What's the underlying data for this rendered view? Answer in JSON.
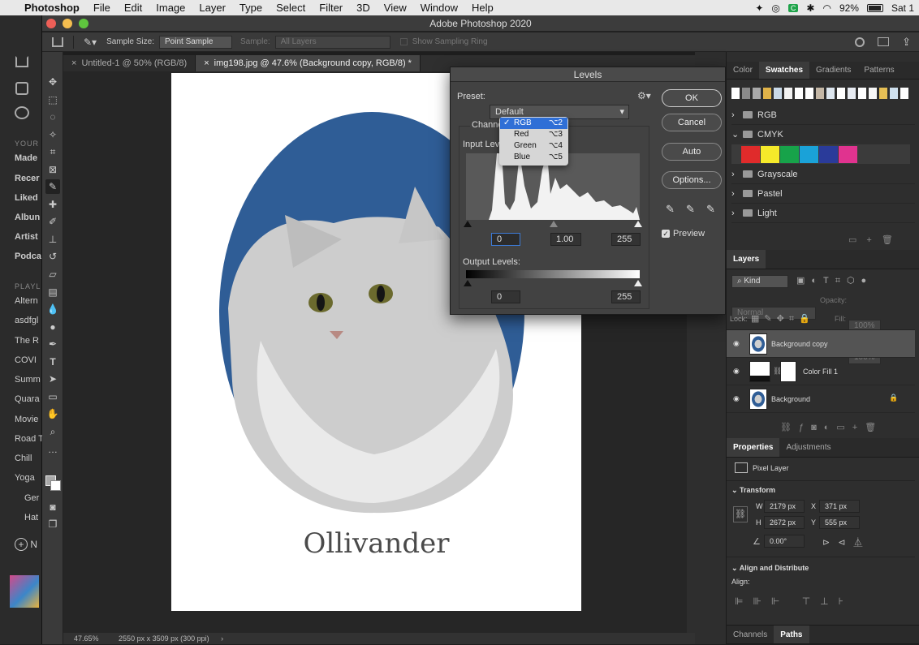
{
  "menubar": {
    "app_name": "Photoshop",
    "items": [
      "File",
      "Edit",
      "Image",
      "Layer",
      "Type",
      "Select",
      "Filter",
      "3D",
      "View",
      "Window",
      "Help"
    ],
    "battery": "92%",
    "clock": "Sat 1"
  },
  "music_sidebar": {
    "section_label": "YOUR",
    "items": [
      "Made",
      "Recer",
      "Liked",
      "Albun",
      "Artist",
      "Podca"
    ],
    "playlists_label": "PLAYL",
    "playlists": [
      "Altern",
      "asdfgl",
      "The R",
      "COVI",
      "Summ",
      "Quara",
      "Movie",
      "Road T",
      "Chill",
      "Yoga",
      "Ger",
      "Hat"
    ],
    "new_label": "N"
  },
  "window": {
    "title": "Adobe Photoshop 2020"
  },
  "options_bar": {
    "sample_size_label": "Sample Size:",
    "sample_size_value": "Point Sample",
    "sample_label": "Sample:",
    "sample_value": "All Layers",
    "ring_label": "Show Sampling Ring"
  },
  "tabs": [
    {
      "label": "Untitled-1 @ 50% (RGB/8)"
    },
    {
      "label": "img198.jpg @ 47.6% (Background copy, RGB/8) *"
    }
  ],
  "canvas": {
    "caption": "Ollivander"
  },
  "status": {
    "zoom": "47.65%",
    "doc_info": "2550 px x 3509 px (300 ppi)"
  },
  "levels": {
    "title": "Levels",
    "preset_label": "Preset:",
    "preset_value": "Default",
    "channel_label": "Channe",
    "input_label": "Input Leve",
    "input_black": "0",
    "input_gamma": "1.00",
    "input_white": "255",
    "output_label": "Output Levels:",
    "output_black": "0",
    "output_white": "255",
    "ok": "OK",
    "cancel": "Cancel",
    "auto": "Auto",
    "options": "Options...",
    "preview": "Preview",
    "channel_menu": [
      {
        "label": "RGB",
        "shortcut": "⌥2",
        "selected": true
      },
      {
        "label": "Red",
        "shortcut": "⌥3"
      },
      {
        "label": "Green",
        "shortcut": "⌥4"
      },
      {
        "label": "Blue",
        "shortcut": "⌥5"
      }
    ]
  },
  "swatches_panel": {
    "tabs": [
      "Color",
      "Swatches",
      "Gradients",
      "Patterns"
    ],
    "active_tab": "Swatches",
    "folders": [
      "RGB",
      "CMYK",
      "Grayscale",
      "Pastel",
      "Light"
    ],
    "cmyk_colors": [
      "#e02b2b",
      "#f5ea2a",
      "#17a34a",
      "#1aa2d8",
      "#2a3b9a",
      "#e0338f"
    ]
  },
  "layers_panel": {
    "title": "Layers",
    "kind": "Kind",
    "blend_mode": "Normal",
    "opacity_label": "Opacity:",
    "opacity": "100%",
    "lock_label": "Lock:",
    "fill_label": "Fill:",
    "fill": "100%",
    "layers": [
      {
        "name": "Background copy",
        "selected": true
      },
      {
        "name": "Color Fill 1"
      },
      {
        "name": "Background",
        "locked": true
      }
    ]
  },
  "properties_panel": {
    "tabs": [
      "Properties",
      "Adjustments"
    ],
    "type_label": "Pixel Layer",
    "transform_label": "Transform",
    "w_label": "W",
    "w": "2179 px",
    "x_label": "X",
    "x": "371 px",
    "h_label": "H",
    "h": "2672 px",
    "y_label": "Y",
    "y": "555 px",
    "angle": "0.00°",
    "align_label": "Align and Distribute",
    "align_sub": "Align:"
  },
  "bottom_tabs": [
    "Channels",
    "Paths"
  ]
}
